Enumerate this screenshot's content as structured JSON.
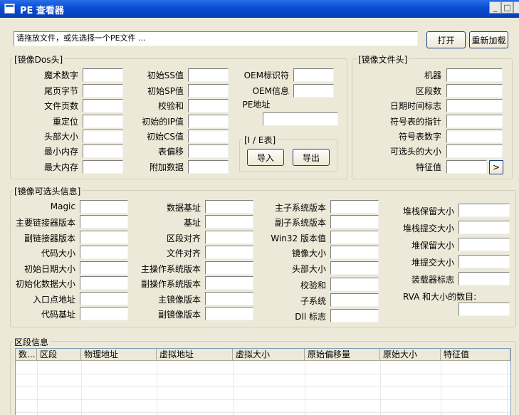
{
  "window": {
    "title": "PE 查看器"
  },
  "path_bar": {
    "placeholder_text": "请拖放文件，或先选择一个PE文件 ...",
    "open_label": "打开",
    "reload_label": "重新加载"
  },
  "dos_header": {
    "title": "[镜像Dos头]",
    "col1": [
      "魔术数字",
      "尾页字节",
      "文件页数",
      "重定位",
      "头部大小",
      "最小内存",
      "最大内存"
    ],
    "col2": [
      "初始SS值",
      "初始SP值",
      "校验和",
      "初始的IP值",
      "初始CS值",
      "表偏移",
      "附加数据"
    ],
    "col3": [
      "OEM标识符",
      "OEM信息",
      "PE地址"
    ],
    "ie": {
      "title": "[I / E表]",
      "import_label": "导入",
      "export_label": "导出"
    }
  },
  "file_header": {
    "title": "[镜像文件头]",
    "labels": [
      "机器",
      "区段数",
      "日期时间标志",
      "符号表的指针",
      "符号表数字",
      "可选头的大小",
      "特征值"
    ],
    "more_label": ">"
  },
  "optional_header": {
    "title": "[镜像可选头信息]",
    "col1": [
      "Magic",
      "主要链接器版本",
      "副链接器版本",
      "代码大小",
      "初始日期大小",
      "初始化数据大小",
      "入口点地址",
      "代码基址"
    ],
    "col2": [
      "数据基址",
      "基址",
      "区段对齐",
      "文件对齐",
      "主操作系统版本",
      "副操作系统版本",
      "主镜像版本",
      "副镜像版本"
    ],
    "col3": [
      "主子系统版本",
      "副子系统版本",
      "Win32 版本值",
      "镜像大小",
      "头部大小",
      "校验和",
      "子系统",
      "Dll 标志"
    ],
    "col4": [
      "堆栈保留大小",
      "堆栈提交大小",
      "堆保留大小",
      "堆提交大小",
      "装载器标志"
    ],
    "rva_label": "RVA 和大小的数目:"
  },
  "sections": {
    "title": "区段信息",
    "columns": [
      "数...",
      "区段",
      "物理地址",
      "虚拟地址",
      "虚拟大小",
      "原始偏移量",
      "原始大小",
      "特征值"
    ]
  }
}
